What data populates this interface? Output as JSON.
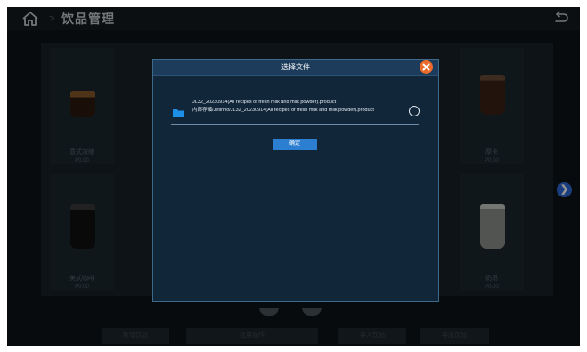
{
  "header": {
    "separator": ">",
    "title": "饮品管理"
  },
  "drinks": [
    {
      "name": "意式浓缩",
      "price": "P0.00",
      "color": "#5a3418"
    },
    {
      "name": "摩卡",
      "price": "P0.00",
      "color": "#3c2418"
    },
    {
      "name": "美式咖啡",
      "price": "P0.00",
      "color": "#1d1d1d"
    },
    {
      "name": "奶昂",
      "price": "P0.00",
      "color": "#8e928e"
    }
  ],
  "pagination": {
    "next_label": "❯",
    "dots": 2
  },
  "actions": [
    {
      "label": "新增饮品"
    },
    {
      "label": "批量操作"
    },
    {
      "label": "导入饮品"
    },
    {
      "label": "导出饮品"
    }
  ],
  "dialog": {
    "title": "选择文件",
    "close_label": "×",
    "files": [
      {
        "name": "JL32_20230914(All recipes of fresh milk and milk powder).product",
        "path": "内部存储/Jetinno/JL32_20230914(All recipes of fresh milk and milk powder).product",
        "selected": false
      }
    ],
    "confirm_label": "确定"
  },
  "colors": {
    "accent": "#2c7fd0",
    "close": "#ea6a2b",
    "dialog_bg": "#12263a",
    "page_indicator": "#2e6bd8"
  },
  "icons": [
    "home-icon",
    "back-icon",
    "folder-icon",
    "close-icon",
    "chevron-right-icon",
    "radio-icon"
  ]
}
